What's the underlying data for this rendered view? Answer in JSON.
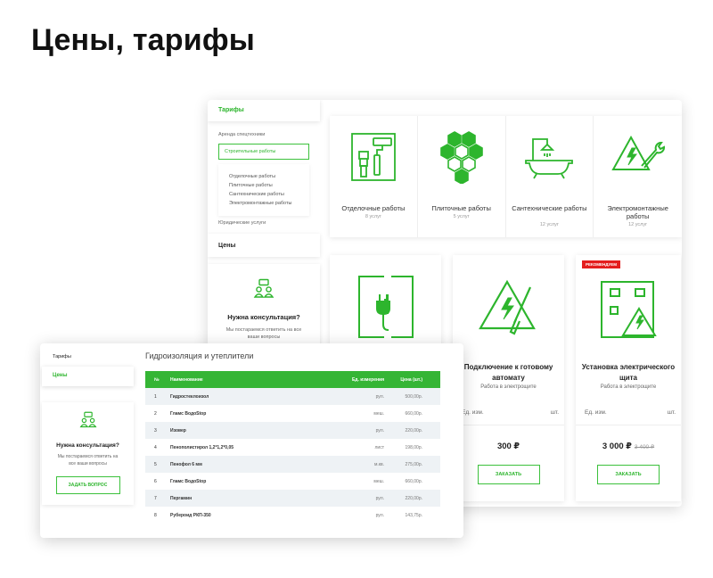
{
  "page_title": "Цены, тарифы",
  "colors": {
    "accent": "#2db52d",
    "badge": "#e41e1e",
    "row_alt": "#eef2f5"
  },
  "back": {
    "sidebar": {
      "tariffs": "Тарифы",
      "rent": "Аренда спецтехники",
      "construction": "Строительные работы",
      "sub_items": [
        "Отделочные работы",
        "Плиточные работы",
        "Сантехнические работы",
        "Электромонтажные работы"
      ],
      "legal": "Юридические услуги",
      "prices": "Цены",
      "consult_title": "Нужна консультация?",
      "consult_text": "Мы постараемся ответить на все ваши вопросы"
    },
    "categories": [
      {
        "name": "Отделочные работы",
        "count": "8 услуг",
        "icon": "paint-tools-icon"
      },
      {
        "name": "Плиточные работы",
        "count": "5 услуг",
        "icon": "hexagon-tiles-icon"
      },
      {
        "name": "Сантехнические работы",
        "count": "12 услуг",
        "icon": "bathtub-icon"
      },
      {
        "name": "Электромонтажные работы",
        "count": "12 услуг",
        "icon": "electric-wrench-icon"
      }
    ],
    "products": [
      {
        "name": "",
        "sub": "",
        "icon": "socket-plug-icon"
      },
      {
        "name": "Подключение к готовому автомату",
        "sub": "Работа в электрощите",
        "unit_label": "Ед. изм.",
        "unit_value": "шт.",
        "price": "300 ₽",
        "old_price": "",
        "button": "ЗАКАЗАТЬ",
        "icon": "warning-screwdriver-icon"
      },
      {
        "name": "Установка электрического щита",
        "sub": "Работа в электрощите",
        "unit_label": "Ед. изм.",
        "unit_value": "шт.",
        "price": "3 000 ₽",
        "old_price": "3 400 ₽",
        "button": "ЗАКАЗАТЬ",
        "badge": "РЕКОМЕНДУЕМ",
        "icon": "electric-panel-icon"
      }
    ]
  },
  "front": {
    "sidebar": {
      "tariffs": "Тарифы",
      "prices": "Цены",
      "consult_title": "Нужна консультация?",
      "consult_text": "Мы постараемся ответить на все ваши вопросы",
      "ask_button": "ЗАДАТЬ ВОПРОС"
    },
    "table_title": "Гидроизоляция и утеплители",
    "columns": [
      "№",
      "Наименование",
      "Ед. измерения",
      "Цена (шт.)"
    ],
    "rows": [
      [
        "1",
        "Гидростеклоизол",
        "рул.",
        "500,00р."
      ],
      [
        "2",
        "Гламс ВодоStop",
        "меш.",
        "660,00р."
      ],
      [
        "3",
        "Изовер",
        "рул.",
        "220,00р."
      ],
      [
        "4",
        "Пенополистирол 1,2*1,2*0,05",
        "лист",
        "198,00р."
      ],
      [
        "5",
        "Пенофол 6 мм",
        "м.кв.",
        "275,00р."
      ],
      [
        "6",
        "Гламс ВодоStop",
        "меш.",
        "660,00р."
      ],
      [
        "7",
        "Пергамин",
        "рул.",
        "220,00р."
      ],
      [
        "8",
        "Рубероид РКП-350",
        "рул.",
        "143,75р."
      ]
    ]
  }
}
